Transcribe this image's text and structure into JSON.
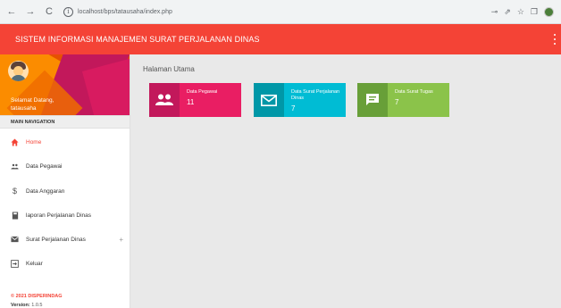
{
  "browser": {
    "url": "localhost/bps/tatausaha/index.php"
  },
  "header": {
    "title": "SISTEM INFORMASI MANAJEMEN SURAT PERJALANAN DINAS"
  },
  "user": {
    "greeting": "Selamat Datang,",
    "name": "tatausaha"
  },
  "nav": {
    "header": "MAIN NAVIGATION",
    "items": [
      {
        "label": "Home",
        "icon": "home-icon"
      },
      {
        "label": "Data Pegawai",
        "icon": "people-icon"
      },
      {
        "label": "Data Anggaran",
        "icon": "dollar-icon"
      },
      {
        "label": "laporan Perjalanan Dinas",
        "icon": "book-icon"
      },
      {
        "label": "Surat Perjalanan Dinas",
        "icon": "mail-icon"
      },
      {
        "label": "Keluar",
        "icon": "logout-icon"
      }
    ],
    "expand_symbol": "+"
  },
  "footer": {
    "copyright": "© 2021 DISPERINDAG",
    "version_label": "Version:",
    "version_value": "1.0.5"
  },
  "main": {
    "title": "Halaman Utama",
    "cards": [
      {
        "title": "Data Pegawai",
        "value": "11",
        "color": "#e91e63",
        "icon": "people-icon"
      },
      {
        "title": "Data Surat Perjalanan Dinas",
        "value": "7",
        "color": "#00bcd4",
        "icon": "mail-icon"
      },
      {
        "title": "Data Surat Tugas",
        "value": "7",
        "color": "#8bc34a",
        "icon": "chat-icon"
      }
    ]
  },
  "colors": {
    "header": "#f44336",
    "active": "#f44336"
  }
}
